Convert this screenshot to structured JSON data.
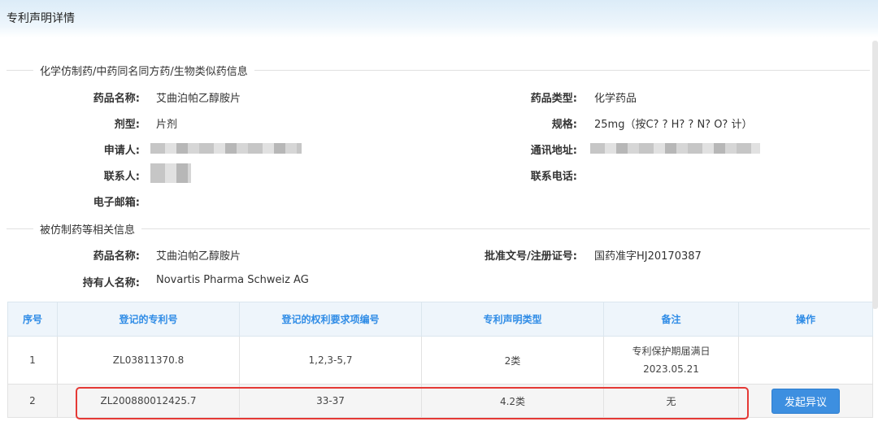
{
  "header": {
    "title": "专利声明详情"
  },
  "section1": {
    "title": "化学仿制药/中药同名同方药/生物类似药信息",
    "drug_name_label": "药品名称:",
    "drug_name": "艾曲泊帕乙醇胺片",
    "drug_type_label": "药品类型:",
    "drug_type": "化学药品",
    "dosage_form_label": "剂型:",
    "dosage_form": "片剂",
    "spec_label": "规格:",
    "spec": "25mg（按C? ? H? ? N? O? 计）",
    "applicant_label": "申请人:",
    "address_label": "通讯地址:",
    "contact_label": "联系人:",
    "phone_label": "联系电话:",
    "email_label": "电子邮箱:"
  },
  "section2": {
    "title": "被仿制药等相关信息",
    "drug_name_label": "药品名称:",
    "drug_name": "艾曲泊帕乙醇胺片",
    "approval_label": "批准文号/注册证号:",
    "approval": "国药准字HJ20170387",
    "holder_label": "持有人名称:",
    "holder": "Novartis Pharma Schweiz AG"
  },
  "table": {
    "headers": [
      "序号",
      "登记的专利号",
      "登记的权利要求项编号",
      "专利声明类型",
      "备注",
      "操作"
    ],
    "rows": [
      {
        "no": "1",
        "patent": "ZL03811370.8",
        "claims": "1,2,3-5,7",
        "type": "2类",
        "remark": "专利保护期届满日2023.05.21",
        "action": ""
      },
      {
        "no": "2",
        "patent": "ZL200880012425.7",
        "claims": "33-37",
        "type": "4.2类",
        "remark": "无",
        "action": "发起异议"
      }
    ]
  },
  "colors": {
    "header_blue": "#2f8ce6",
    "button_blue": "#3d8fe0",
    "highlight_red": "#e53935"
  }
}
